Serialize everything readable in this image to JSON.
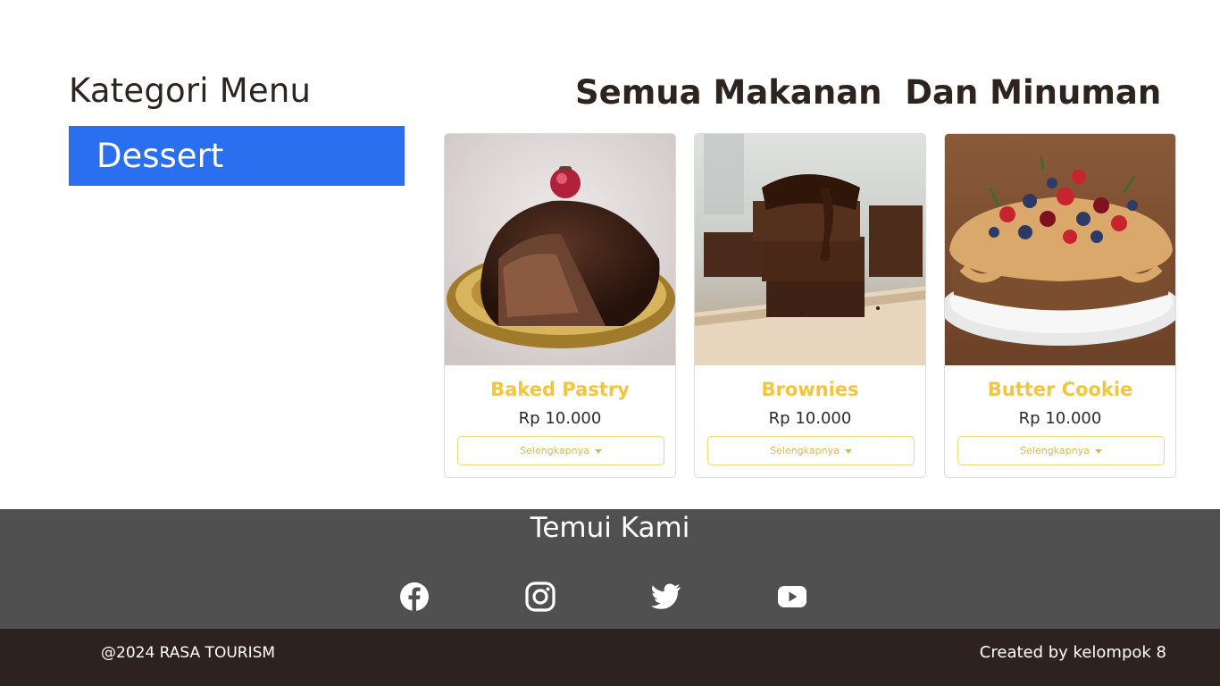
{
  "sidebar": {
    "title": "Kategori Menu",
    "items": [
      {
        "label": "Dessert"
      }
    ]
  },
  "main": {
    "title": "Semua Makanan  Dan Minuman",
    "products": [
      {
        "name": "Baked Pastry",
        "price": "Rp 10.000",
        "button": "Selengkapnya"
      },
      {
        "name": "Brownies",
        "price": "Rp 10.000",
        "button": "Selengkapnya"
      },
      {
        "name": "Butter Cookie",
        "price": "Rp 10.000",
        "button": "Selengkapnya"
      }
    ]
  },
  "footer": {
    "title": "Temui Kami",
    "social": [
      {
        "icon": "facebook-icon"
      },
      {
        "icon": "instagram-icon"
      },
      {
        "icon": "twitter-icon"
      },
      {
        "icon": "youtube-icon"
      }
    ],
    "copyright": "@2024 RASA TOURISM",
    "credit": "Created by kelompok 8"
  },
  "colors": {
    "accent": "#2a6ff0",
    "product_name": "#f2c53d",
    "footer_bg": "#505050",
    "bottom_bar_bg": "#2e221e"
  }
}
